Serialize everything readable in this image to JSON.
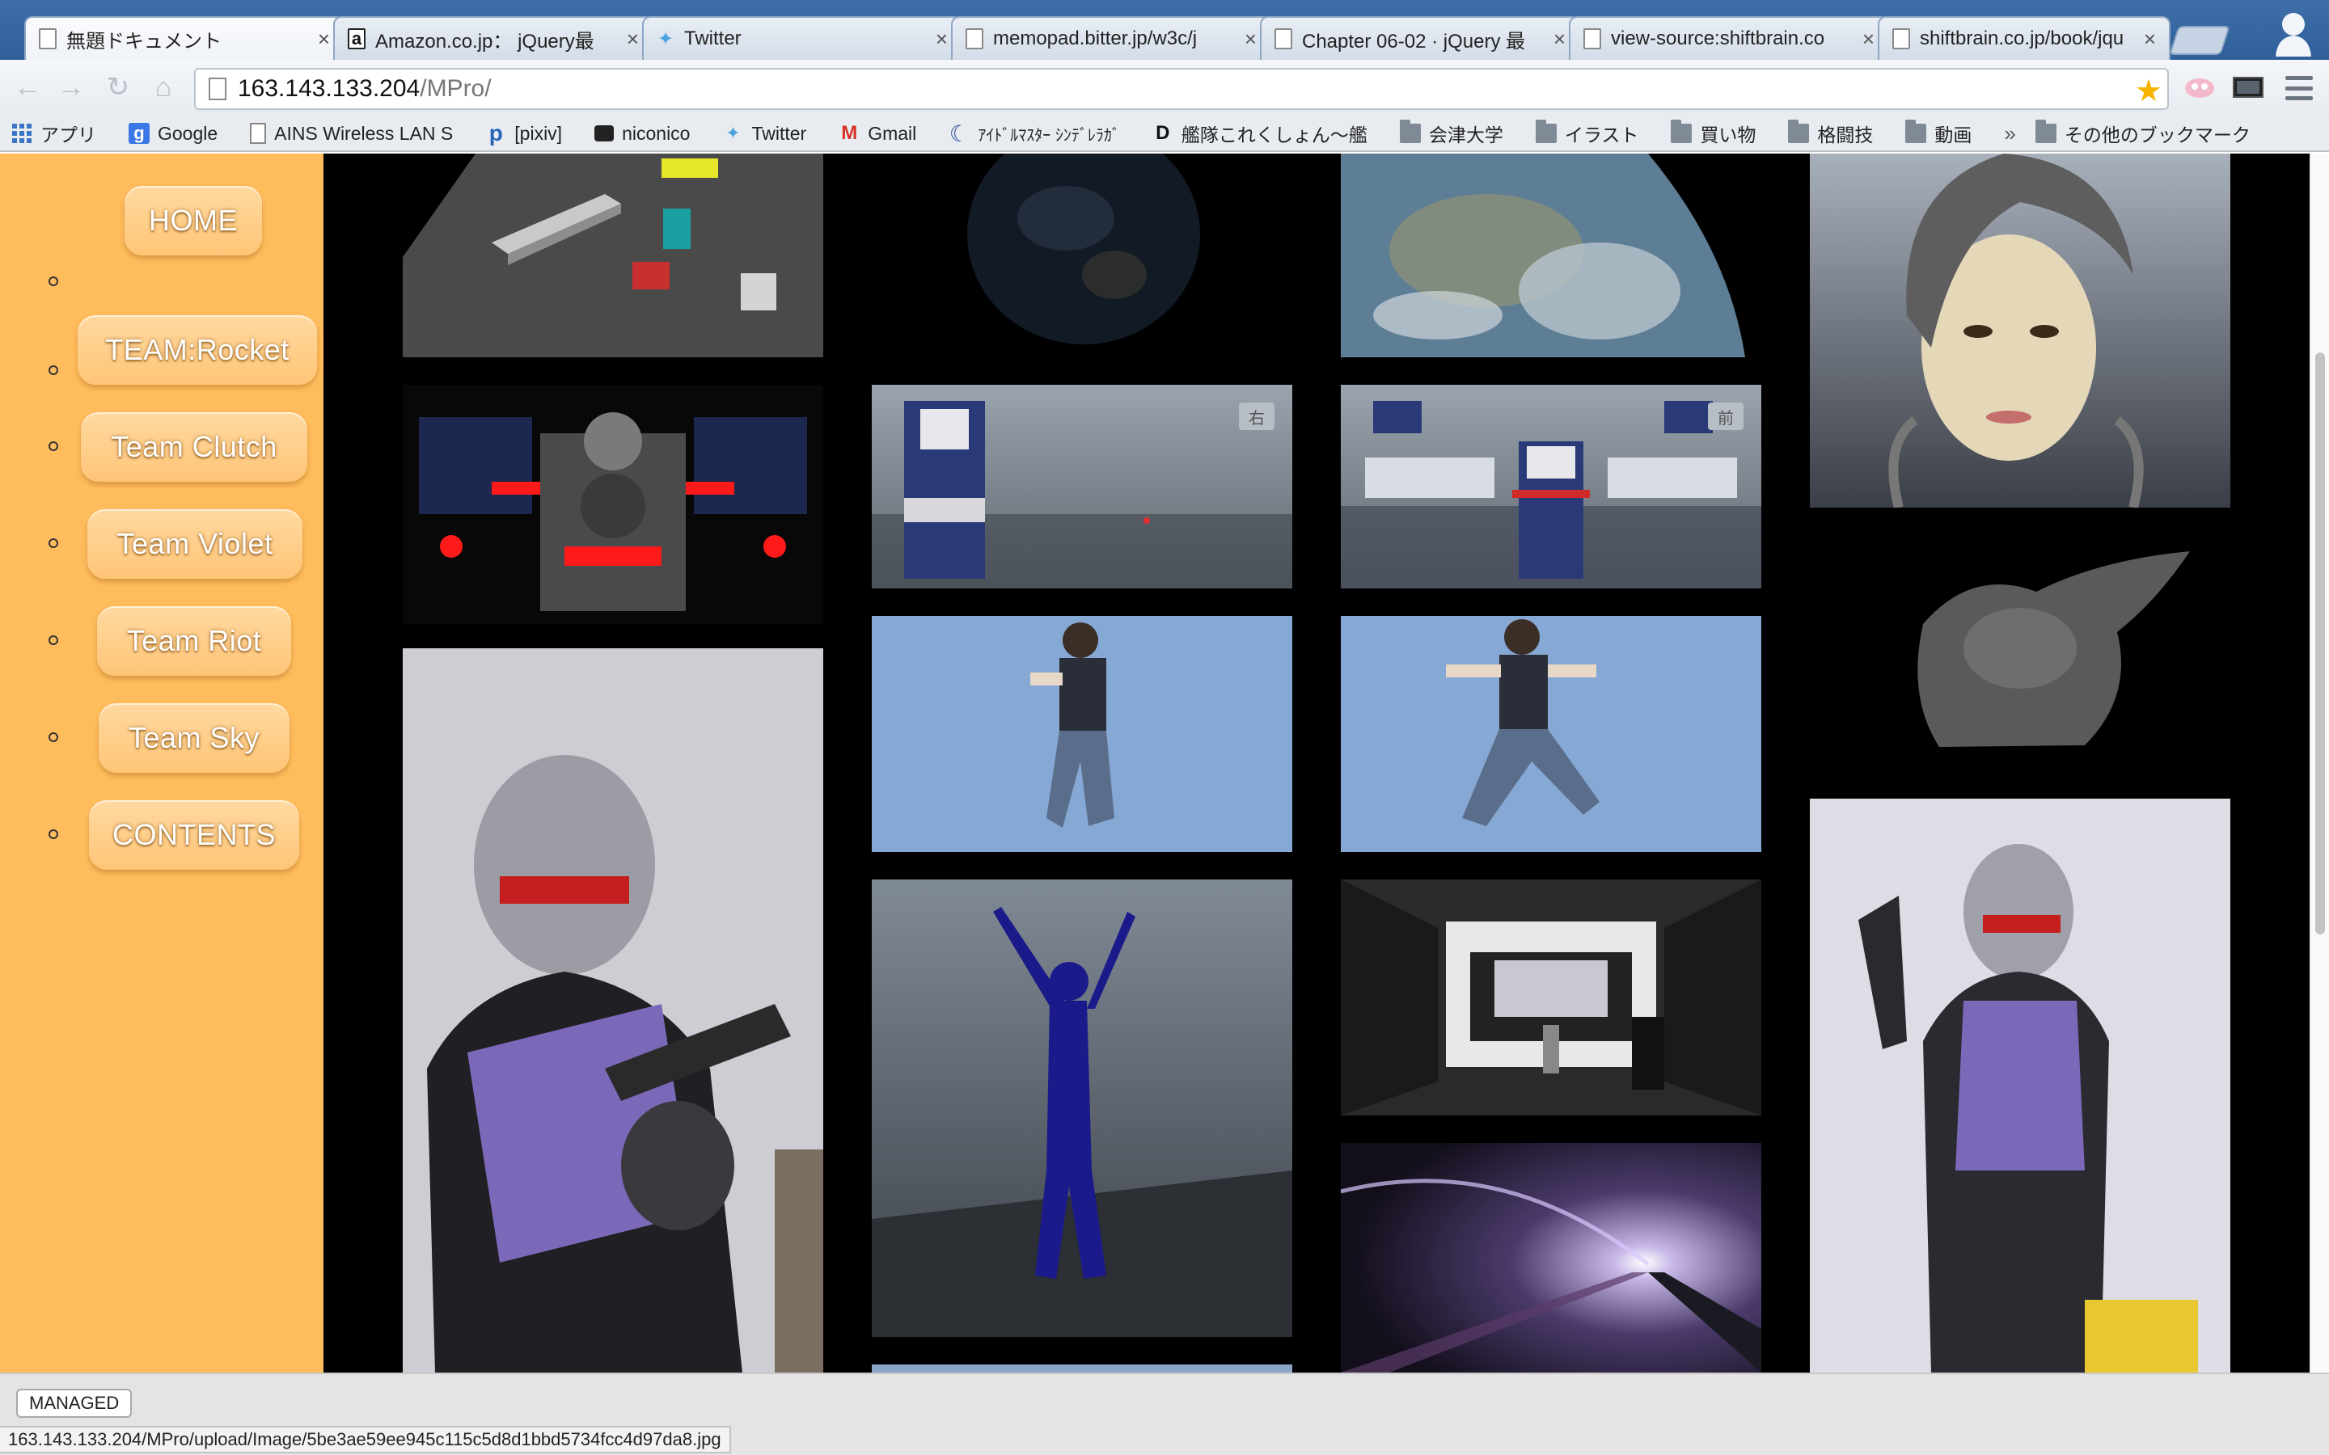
{
  "browser": {
    "tabs": [
      {
        "title": "無題ドキュメント",
        "icon": "page-icon",
        "active": true
      },
      {
        "title": "Amazon.co.jp： jQuery最",
        "icon": "amazon-icon"
      },
      {
        "title": "Twitter",
        "icon": "twitter-bird-icon"
      },
      {
        "title": "memopad.bitter.jp/w3c/j",
        "icon": "page-icon"
      },
      {
        "title": "Chapter 06-02 · jQuery 最",
        "icon": "page-icon"
      },
      {
        "title": "view-source:shiftbrain.co",
        "icon": "page-icon"
      },
      {
        "title": "shiftbrain.co.jp/book/jqu",
        "icon": "page-icon"
      }
    ],
    "tab_close_glyph": "×",
    "url_host": "163.143.133.204",
    "url_path": "/MPro/",
    "bookmarks": [
      {
        "label": "アプリ",
        "icon": "apps-grid-icon"
      },
      {
        "label": "Google",
        "icon": "google-icon"
      },
      {
        "label": "AINS Wireless LAN S",
        "icon": "page-icon"
      },
      {
        "label": "[pixiv]",
        "icon": "pixiv-icon"
      },
      {
        "label": "niconico",
        "icon": "niconico-icon"
      },
      {
        "label": "Twitter",
        "icon": "twitter-bird-icon"
      },
      {
        "label": "Gmail",
        "icon": "gmail-icon"
      },
      {
        "label": "ｱｲﾄﾞﾙﾏｽﾀｰ ｼﾝﾃﾞﾚﾗｶﾞ",
        "icon": "moon-icon"
      },
      {
        "label": "艦隊これくしょん〜艦",
        "icon": "dmm-icon"
      },
      {
        "label": "会津大学",
        "icon": "folder-icon"
      },
      {
        "label": "イラスト",
        "icon": "folder-icon"
      },
      {
        "label": "買い物",
        "icon": "folder-icon"
      },
      {
        "label": "格闘技",
        "icon": "folder-icon"
      },
      {
        "label": "動画",
        "icon": "folder-icon"
      }
    ],
    "bookmarks_overflow": "»",
    "other_bookmarks": "その他のブックマーク"
  },
  "sidebar": {
    "items": [
      {
        "label": "HOME"
      },
      {
        "label": "TEAM:Rocket"
      },
      {
        "label": "Team Clutch"
      },
      {
        "label": "Team Violet"
      },
      {
        "label": "Team Riot"
      },
      {
        "label": "Team Sky"
      },
      {
        "label": "CONTENTS"
      }
    ]
  },
  "gallery": {
    "images": [
      "city-model-render",
      "earth-night-render",
      "earth-day-render",
      "female-face-model",
      "robot-mech-render",
      "robot-rig-viewport-side",
      "robot-rig-viewport-front",
      "dragon-sculpt-render",
      "cosplay-helmet-pistol-photo",
      "boy-character-punch-render",
      "boy-character-jump-render",
      "wireframe-figure-render",
      "hangar-room-render",
      "cosplay-standing-pistol-photo",
      "tunnel-light-render"
    ],
    "viewport_label_side": "右",
    "viewport_label_front": "前"
  },
  "downloads": {
    "managed_label": "MANAGED"
  },
  "status": {
    "text": "163.143.133.204/MPro/upload/Image/5be3ae59ee945c115c5d8d1bbd5734fcc4d97da8.jpg"
  },
  "colors": {
    "sidebar": "#ffbc5c",
    "page_bg": "#000000",
    "tabbar": "#3467a6"
  }
}
